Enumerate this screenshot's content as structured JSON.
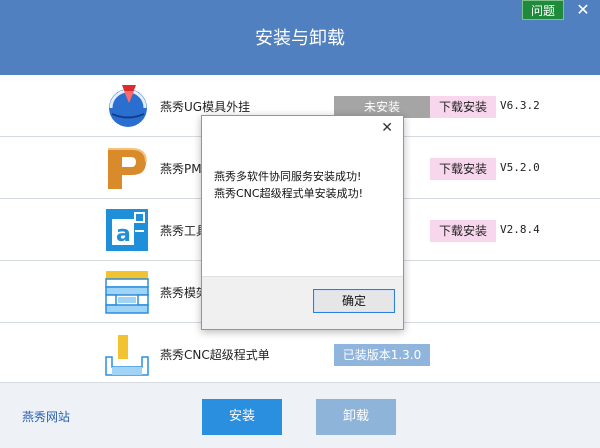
{
  "header": {
    "title": "安装与卸载",
    "help_label": "问题",
    "close_label": "✕"
  },
  "rows": [
    {
      "name": "燕秀UG模具外挂",
      "status": "未安装",
      "download": "下载安装",
      "version": "V6.3.2",
      "icon": "ug-globe-icon"
    },
    {
      "name": "燕秀PMS",
      "status": "",
      "download": "下载安装",
      "version": "V5.2.0",
      "icon": "pms-p-icon"
    },
    {
      "name": "燕秀工具",
      "status": "",
      "download": "下载安装",
      "version": "V2.8.4",
      "icon": "tools-a-icon"
    },
    {
      "name": "燕秀模架",
      "status": "",
      "download": "",
      "version": "",
      "icon": "mold-base-icon"
    },
    {
      "name": "燕秀CNC超级程式单",
      "status": "已装版本1.3.0",
      "download": "",
      "version": "",
      "icon": "cnc-icon"
    }
  ],
  "footer": {
    "site_link": "燕秀网站",
    "install_label": "安装",
    "uninstall_label": "卸载"
  },
  "dialog": {
    "close_label": "✕",
    "message_line1": "燕秀多软件协同服务安装成功!",
    "message_line2": "燕秀CNC超级程式单安装成功!",
    "ok_label": "确定"
  }
}
